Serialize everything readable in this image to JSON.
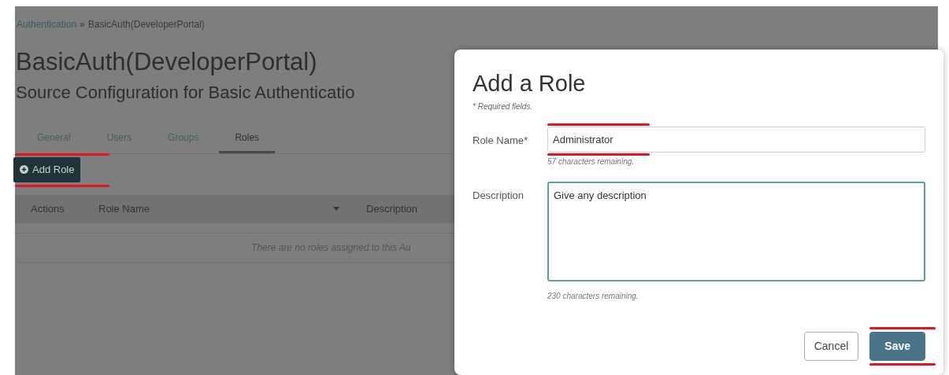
{
  "breadcrumb": [
    {
      "label": "Authentication",
      "kind": "link"
    },
    {
      "label": "BasicAuth(DeveloperPortal)",
      "kind": "current"
    }
  ],
  "breadcrumb_separator": "»",
  "page": {
    "title": "BasicAuth(DeveloperPortal)",
    "subtitle": "Source Configuration for Basic Authenticatio"
  },
  "tabs": [
    {
      "label": "General",
      "selected": false
    },
    {
      "label": "Users",
      "selected": false
    },
    {
      "label": "Groups",
      "selected": false
    },
    {
      "label": "Roles",
      "selected": true
    }
  ],
  "add_button": {
    "label": "Add Role",
    "highlighted": true
  },
  "table": {
    "columns": [
      {
        "label": "Actions",
        "sorted": false
      },
      {
        "label": "Role Name",
        "sorted": true
      },
      {
        "label": "Description",
        "sorted": false
      }
    ],
    "empty_message": "There are no roles assigned to this Au"
  },
  "dialog": {
    "title": "Add a Role",
    "required_note": "* Required fields.",
    "fields": [
      {
        "label": "Role Name*",
        "kind": "input",
        "value": "Administrator",
        "hint": "57 characters remaining.",
        "focused": false,
        "highlighted": true
      },
      {
        "label": "Description",
        "kind": "textarea",
        "value": "Give any description",
        "hint": "230 characters remaining.",
        "focused": true,
        "highlighted": false
      }
    ],
    "buttons": [
      {
        "label": "Cancel",
        "kind": "secondary",
        "highlighted": false
      },
      {
        "label": "Save",
        "kind": "primary",
        "highlighted": true
      }
    ]
  }
}
